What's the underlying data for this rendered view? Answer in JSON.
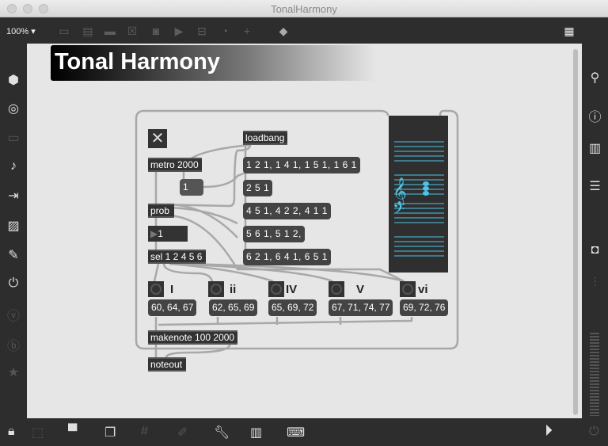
{
  "window": {
    "title": "TonalHarmony"
  },
  "toolbar": {
    "zoom": "100%",
    "zoom_arrow": "▾"
  },
  "patch": {
    "title": "Tonal Harmony",
    "toggle": "✕",
    "metro": "metro 2000",
    "one_msg": "1",
    "prob": "prob",
    "number": "1",
    "sel": "sel 1 2 4 5 6",
    "loadbang": "loadbang",
    "prob_msgs": [
      "1 2 1, 1 4 1, 1 5 1, 1 6 1",
      "2 5 1",
      "4 5 1, 4 2 2, 4 1 1",
      "5 6 1, 5 1 2,",
      "6 2 1, 6 4 1, 6 5 1"
    ],
    "chords": [
      {
        "label": "I",
        "notes": "60, 64, 67"
      },
      {
        "label": "ii",
        "notes": "62, 65, 69"
      },
      {
        "label": "IV",
        "notes": "65, 69, 72"
      },
      {
        "label": "V",
        "notes": "67, 71, 74, 77"
      },
      {
        "label": "vi",
        "notes": "69, 72, 76"
      }
    ],
    "makenote": "makenote 100 2000",
    "noteout": "noteout",
    "staff_color": "#4cc4e8"
  }
}
